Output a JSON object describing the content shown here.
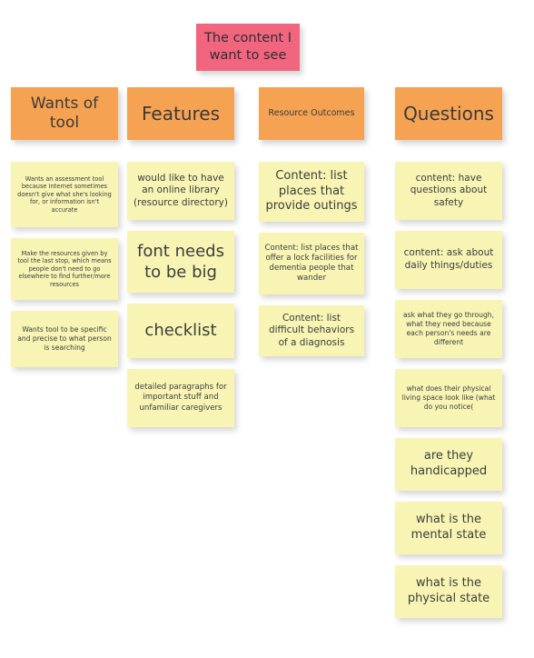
{
  "banner": {
    "text": "The content I want to see",
    "color": "#f1657f"
  },
  "colors": {
    "header_note": "#f5a253",
    "content_note": "#f7f4b4",
    "banner_note": "#f1657f",
    "page_background": "#ffffff",
    "text": "#3b3b3b"
  },
  "columns": [
    {
      "header": "Wants of tool",
      "notes": [
        "Wants an assessment tool because Internet sometimes doesn't give what she's looking for, or information isn't accurate",
        "Make the resources given by tool the last stop, which means people don't need to go elsewhere to find further/more resources",
        "Wants tool to be specific and precise to what person is searching"
      ]
    },
    {
      "header": "Features",
      "notes": [
        "would like to have an online library (resource directory)",
        "font needs to be big",
        "checklist",
        "detailed paragraphs for important stuff and unfamiliar caregivers"
      ]
    },
    {
      "header": "Resource Outcomes",
      "notes": [
        "Content: list places that provide outings",
        "Content: list places that offer a lock facilities for dementia people that wander",
        "Content: list difficult behaviors of a diagnosis"
      ]
    },
    {
      "header": "Questions",
      "notes": [
        "content: have questions about safety",
        "content: ask about daily things/duties",
        "ask what they go through, what they need because each person's needs are different",
        "what does their physical living space look like (what do you notice(",
        "are they handicapped",
        "what is the mental state",
        "what is the physical state"
      ]
    }
  ]
}
